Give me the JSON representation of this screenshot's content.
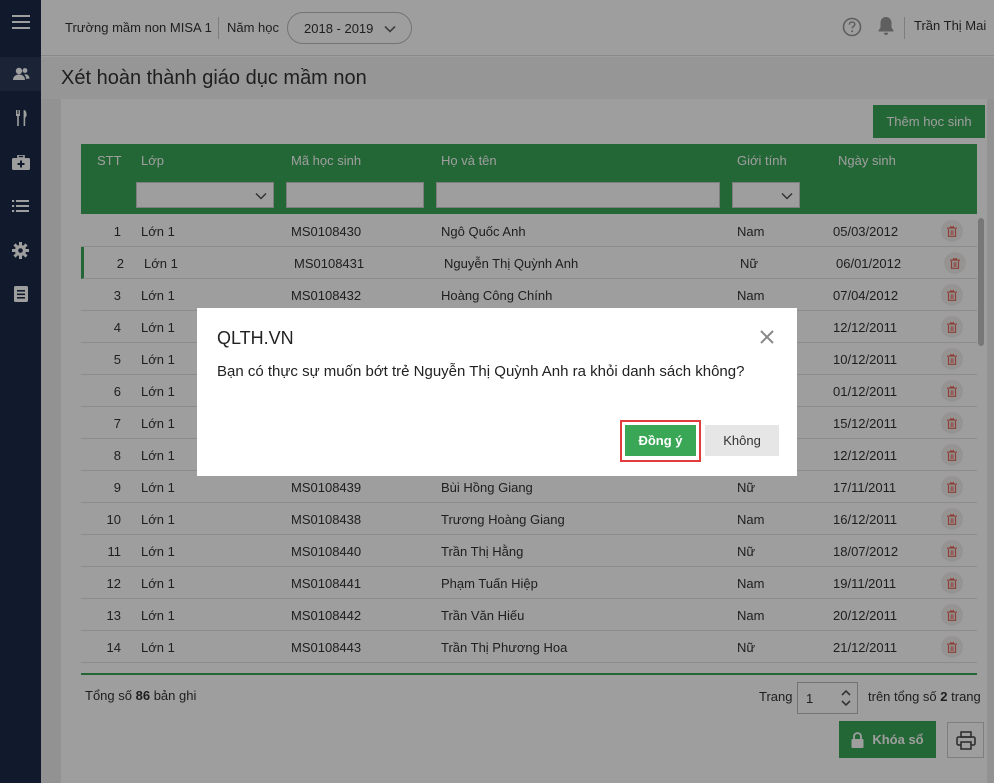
{
  "sidebar": {
    "items": [
      {
        "icon": "menu-icon"
      },
      {
        "icon": "users-icon"
      },
      {
        "icon": "utensils-icon"
      },
      {
        "icon": "medkit-icon"
      },
      {
        "icon": "list-icon"
      },
      {
        "icon": "gear-icon"
      },
      {
        "icon": "report-icon"
      }
    ]
  },
  "header": {
    "school": "Trường mầm non MISA 1",
    "year_label": "Năm học",
    "year_value": "2018 - 2019",
    "user": "Trần Thị Mai"
  },
  "page": {
    "title": "Xét hoàn thành giáo dục mầm non",
    "add_button": "Thêm học sinh"
  },
  "grid": {
    "columns": {
      "stt": "STT",
      "lop": "Lớp",
      "ma": "Mã học sinh",
      "ten": "Họ và tên",
      "gioitinh": "Giới tính",
      "ngaysinh": "Ngày sinh"
    },
    "rows": [
      {
        "stt": "1",
        "lop": "Lớn 1",
        "ma": "MS0108430",
        "ten": "Ngô Quốc Anh",
        "gt": "Nam",
        "ns": "05/03/2012"
      },
      {
        "stt": "2",
        "lop": "Lớn 1",
        "ma": "MS0108431",
        "ten": "Nguyễn Thị Quỳnh Anh",
        "gt": "Nữ",
        "ns": "06/01/2012"
      },
      {
        "stt": "3",
        "lop": "Lớn 1",
        "ma": "MS0108432",
        "ten": "Hoàng Công Chính",
        "gt": "Nam",
        "ns": "07/04/2012"
      },
      {
        "stt": "4",
        "lop": "Lớn 1",
        "ma": "",
        "ten": "",
        "gt": "",
        "ns": "12/12/2011"
      },
      {
        "stt": "5",
        "lop": "Lớn 1",
        "ma": "",
        "ten": "",
        "gt": "",
        "ns": "10/12/2011"
      },
      {
        "stt": "6",
        "lop": "Lớn 1",
        "ma": "",
        "ten": "",
        "gt": "",
        "ns": "01/12/2011"
      },
      {
        "stt": "7",
        "lop": "Lớn 1",
        "ma": "",
        "ten": "",
        "gt": "",
        "ns": "15/12/2011"
      },
      {
        "stt": "8",
        "lop": "Lớn 1",
        "ma": "",
        "ten": "",
        "gt": "",
        "ns": "12/12/2011"
      },
      {
        "stt": "9",
        "lop": "Lớn 1",
        "ma": "MS0108439",
        "ten": "Bùi Hồng Giang",
        "gt": "Nữ",
        "ns": "17/11/2011"
      },
      {
        "stt": "10",
        "lop": "Lớn 1",
        "ma": "MS0108438",
        "ten": "Trương Hoàng Giang",
        "gt": "Nam",
        "ns": "16/12/2011"
      },
      {
        "stt": "11",
        "lop": "Lớn 1",
        "ma": "MS0108440",
        "ten": "Trần Thị Hằng",
        "gt": "Nữ",
        "ns": "18/07/2012"
      },
      {
        "stt": "12",
        "lop": "Lớn 1",
        "ma": "MS0108441",
        "ten": "Phạm Tuấn Hiệp",
        "gt": "Nam",
        "ns": "19/11/2011"
      },
      {
        "stt": "13",
        "lop": "Lớn 1",
        "ma": "MS0108442",
        "ten": "Trần Văn Hiếu",
        "gt": "Nam",
        "ns": "20/12/2011"
      },
      {
        "stt": "14",
        "lop": "Lớn 1",
        "ma": "MS0108443",
        "ten": "Trần Thị Phương Hoa",
        "gt": "Nữ",
        "ns": "21/12/2011"
      }
    ]
  },
  "footer": {
    "total_prefix": "Tổng số",
    "total_count": "86",
    "total_suffix": "bản ghi",
    "page_label": "Trang",
    "page_value": "1",
    "pages_prefix": "trên tổng số",
    "pages_count": "2",
    "pages_suffix": "trang",
    "lock_button": "Khóa sổ"
  },
  "dialog": {
    "title": "QLTH.VN",
    "message": "Bạn có thực sự muốn bớt trẻ Nguyễn Thị Quỳnh Anh ra khỏi danh sách không?",
    "ok": "Đồng ý",
    "cancel": "Không"
  },
  "colors": {
    "accent": "#3aa757",
    "sidebar": "#1b2a47",
    "highlight_border": "#e23b3b"
  }
}
